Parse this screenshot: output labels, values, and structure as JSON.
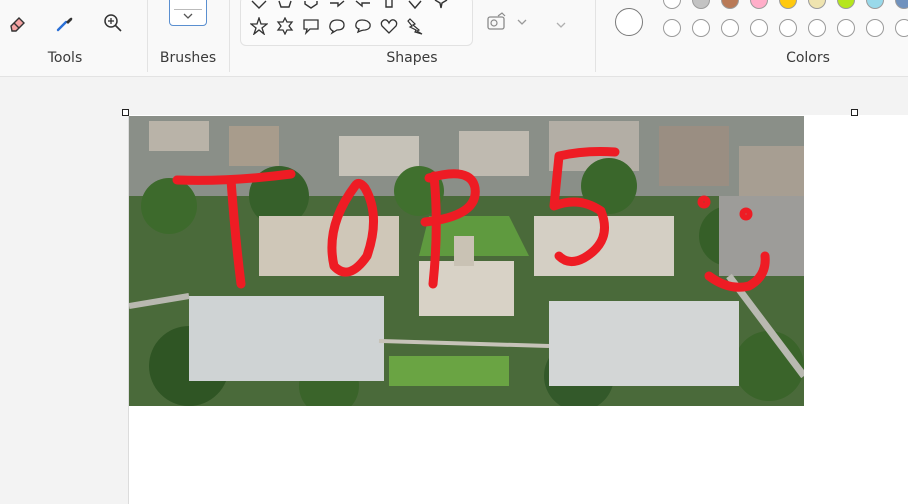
{
  "ribbon": {
    "groups": {
      "tools": "Tools",
      "brushes": "Brushes",
      "shapes": "Shapes",
      "colors": "Colors"
    },
    "tools": [
      {
        "name": "eraser-icon"
      },
      {
        "name": "color-picker-icon"
      },
      {
        "name": "magnifier-icon"
      }
    ]
  },
  "colors": {
    "selected": "#ffffff",
    "row1": [
      "#ffffff",
      "#c3c3c3",
      "#b97a57",
      "#ffaec9",
      "#ffc90e",
      "#efe4b0",
      "#b5e61d",
      "#99d9ea",
      "#7092be"
    ],
    "row2": [
      "#ffffff",
      "#ffffff",
      "#ffffff",
      "#ffffff",
      "#ffffff",
      "#ffffff",
      "#ffffff",
      "#ffffff",
      "#ffffff"
    ]
  },
  "canvas": {
    "drawn_text_color": "#ee1c24"
  }
}
